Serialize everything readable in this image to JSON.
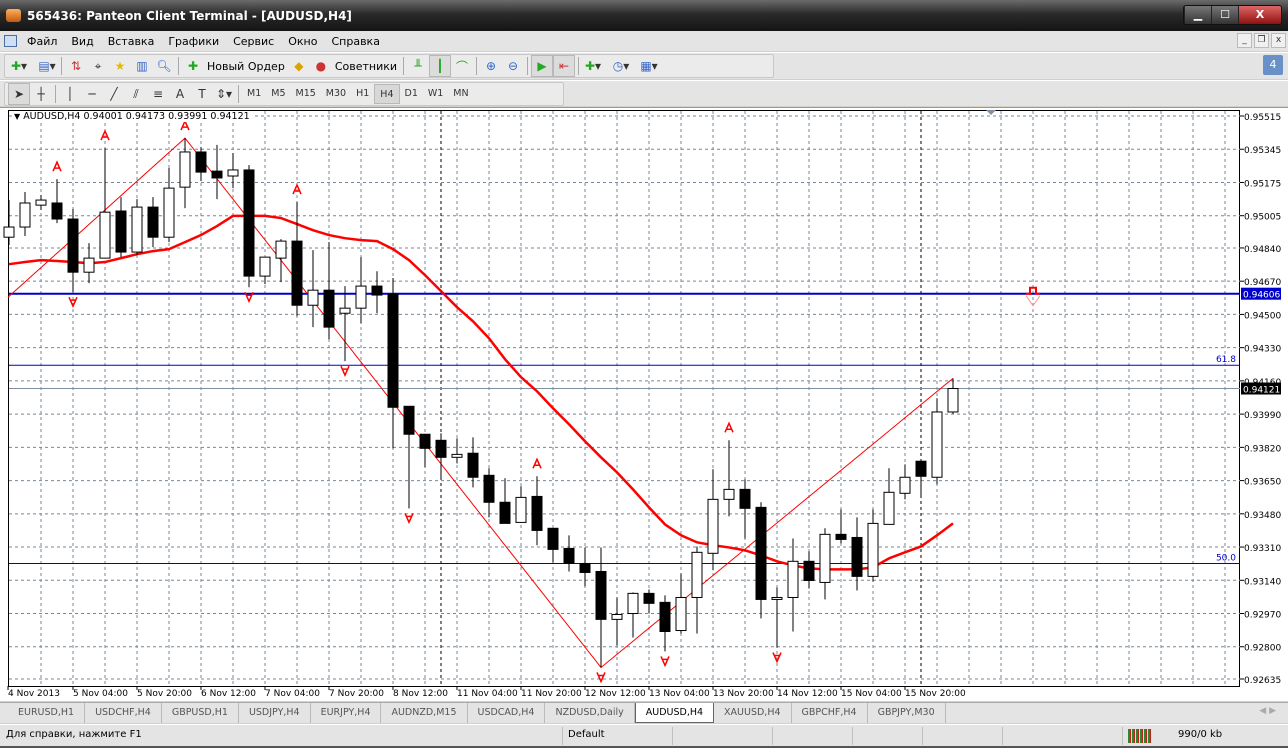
{
  "window": {
    "title": "565436: Panteon Client Terminal - [AUDUSD,H4]",
    "min": "▁",
    "max": "☐",
    "close": "X"
  },
  "menu": {
    "items": [
      "Файл",
      "Вид",
      "Вставка",
      "Графики",
      "Сервис",
      "Окно",
      "Справка"
    ],
    "mdi": [
      "_",
      "❐",
      "x"
    ]
  },
  "toolbar": {
    "new_order": "Новый Ордер",
    "experts": "Советники",
    "notifications": "4"
  },
  "timeframes": {
    "items": [
      "M1",
      "M5",
      "M15",
      "M30",
      "H1",
      "H4",
      "D1",
      "W1",
      "MN"
    ],
    "active": "H4"
  },
  "chart_header": "AUDUSD,H4  0.94001 0.94173 0.93991 0.94121",
  "colors": {
    "bull_body": "#ffffff",
    "bear_body": "#000000",
    "ma": "#ff0000",
    "zigzag": "#ff0000",
    "hline": "#0000cc",
    "fibo": "#0000cc",
    "grid": "#778899"
  },
  "chart_data": {
    "type": "candlestick",
    "symbol": "AUDUSD",
    "timeframe": "H4",
    "ylim": [
      0.92635,
      0.95515
    ],
    "grid": true,
    "price_ticks": [
      "0.95515",
      "0.95345",
      "0.95175",
      "0.95005",
      "0.94840",
      "0.94670",
      "0.94500",
      "0.94330",
      "0.94160",
      "0.93990",
      "0.93820",
      "0.93650",
      "0.93480",
      "0.93310",
      "0.93140",
      "0.92970",
      "0.92800",
      "0.92635"
    ],
    "time_labels": [
      {
        "i": 0,
        "t": "4 Nov 2013"
      },
      {
        "i": 4,
        "t": "5 Nov 04:00"
      },
      {
        "i": 8,
        "t": "5 Nov 20:00"
      },
      {
        "i": 12,
        "t": "6 Nov 12:00"
      },
      {
        "i": 16,
        "t": "7 Nov 04:00"
      },
      {
        "i": 20,
        "t": "7 Nov 20:00"
      },
      {
        "i": 24,
        "t": "8 Nov 12:00"
      },
      {
        "i": 28,
        "t": "11 Nov 04:00"
      },
      {
        "i": 32,
        "t": "11 Nov 20:00"
      },
      {
        "i": 36,
        "t": "12 Nov 12:00"
      },
      {
        "i": 40,
        "t": "13 Nov 04:00"
      },
      {
        "i": 44,
        "t": "13 Nov 20:00"
      },
      {
        "i": 48,
        "t": "14 Nov 12:00"
      },
      {
        "i": 52,
        "t": "15 Nov 04:00"
      },
      {
        "i": 56,
        "t": "15 Nov 20:00"
      }
    ],
    "open": [
      0.94895,
      0.94947,
      0.95059,
      0.9507,
      0.94988,
      0.94716,
      0.94788,
      0.95029,
      0.94819,
      0.95049,
      0.94895,
      0.95151,
      0.95331,
      0.95233,
      0.95208,
      0.95239,
      0.94696,
      0.94788,
      0.94875,
      0.94547,
      0.94624,
      0.94506,
      0.94532,
      0.94645,
      0.94604,
      0.9403,
      0.93887,
      0.93856,
      0.93769,
      0.9379,
      0.93677,
      0.93539,
      0.93436,
      0.93569,
      0.93406,
      0.93303,
      0.93226,
      0.93185,
      0.9294,
      0.9297,
      0.93073,
      0.93027,
      0.92883,
      0.93052,
      0.93278,
      0.93554,
      0.93605,
      0.93513,
      0.93042,
      0.93052,
      0.93237,
      0.93129,
      0.93375,
      0.93359,
      0.9316,
      0.93426,
      0.93585,
      0.93749,
      0.93667,
      0.94001
    ],
    "high": [
      0.95085,
      0.95126,
      0.95111,
      0.95192,
      0.95039,
      0.94865,
      0.95351,
      0.951,
      0.9509,
      0.951,
      0.95249,
      0.95402,
      0.95356,
      0.95367,
      0.95326,
      0.95264,
      0.94793,
      0.94885,
      0.95075,
      0.94829,
      0.9487,
      0.94645,
      0.94793,
      0.94721,
      0.94686,
      0.9403,
      0.93887,
      0.93892,
      0.93866,
      0.93871,
      0.93713,
      0.93662,
      0.93621,
      0.93672,
      0.93406,
      0.9337,
      0.93308,
      0.93308,
      0.93052,
      0.93078,
      0.93093,
      0.93063,
      0.93175,
      0.93313,
      0.93708,
      0.93856,
      0.93656,
      0.93539,
      0.93103,
      0.93354,
      0.93288,
      0.93406,
      0.93503,
      0.93462,
      0.93503,
      0.93713,
      0.93733,
      0.93749,
      0.94071,
      0.94173
    ],
    "low": [
      0.94855,
      0.94901,
      0.95034,
      0.94967,
      0.94614,
      0.9466,
      0.94788,
      0.94793,
      0.94803,
      0.94844,
      0.9487,
      0.95044,
      0.95182,
      0.9509,
      0.95146,
      0.94639,
      0.94655,
      0.94665,
      0.94491,
      0.94435,
      0.94373,
      0.94261,
      0.94455,
      0.94506,
      0.93815,
      0.93508,
      0.93718,
      0.93662,
      0.93738,
      0.93615,
      0.93462,
      0.93431,
      0.93436,
      0.93319,
      0.93231,
      0.93185,
      0.93109,
      0.92694,
      0.92807,
      0.92847,
      0.9297,
      0.92776,
      0.92868,
      0.92868,
      0.93191,
      0.93467,
      0.93354,
      0.92945,
      0.92796,
      0.92878,
      0.93098,
      0.93042,
      0.93329,
      0.93088,
      0.93134,
      0.93426,
      0.93554,
      0.93569,
      0.93631,
      0.93991
    ],
    "close": [
      0.94947,
      0.9507,
      0.95085,
      0.94988,
      0.94716,
      0.94788,
      0.95023,
      0.94819,
      0.95049,
      0.94895,
      0.95146,
      0.95331,
      0.95228,
      0.95198,
      0.95239,
      0.94696,
      0.94793,
      0.94875,
      0.94547,
      0.94624,
      0.94435,
      0.94532,
      0.94645,
      0.94599,
      0.94025,
      0.93887,
      0.93815,
      0.93769,
      0.93784,
      0.93667,
      0.93539,
      0.93431,
      0.93564,
      0.93395,
      0.93298,
      0.93226,
      0.9318,
      0.9294,
      0.92965,
      0.93073,
      0.93022,
      0.92878,
      0.93052,
      0.93283,
      0.93554,
      0.93605,
      0.93508,
      0.93042,
      0.93052,
      0.93237,
      0.93139,
      0.93375,
      0.93349,
      0.9316,
      0.93431,
      0.9359,
      0.93667,
      0.93672,
      0.94001,
      0.94121
    ],
    "ma": [
      0.94757,
      0.94768,
      0.94778,
      0.94773,
      0.94768,
      0.94762,
      0.94768,
      0.94788,
      0.94808,
      0.94824,
      0.94834,
      0.9487,
      0.94906,
      0.94952,
      0.95004,
      0.95004,
      0.95004,
      0.94993,
      0.94962,
      0.94931,
      0.94906,
      0.9489,
      0.9488,
      0.94875,
      0.94834,
      0.94778,
      0.94701,
      0.94619,
      0.94537,
      0.94465,
      0.94378,
      0.94271,
      0.94179,
      0.94107,
      0.9402,
      0.93938,
      0.93851,
      0.93769,
      0.93692,
      0.93605,
      0.93513,
      0.93426,
      0.9337,
      0.93334,
      0.93319,
      0.93308,
      0.93293,
      0.93267,
      0.93237,
      0.93216,
      0.93201,
      0.93196,
      0.93196,
      0.93196,
      0.93206,
      0.93252,
      0.93283,
      0.93313,
      0.9337,
      0.93431
    ],
    "zigzag": [
      {
        "i": 0,
        "p": 0.94588
      },
      {
        "i": 11,
        "p": 0.95402
      },
      {
        "i": 37,
        "p": 0.92694
      },
      {
        "i": 59,
        "p": 0.94173
      }
    ],
    "fractals_up": [
      3,
      6,
      11,
      18,
      33,
      45
    ],
    "fractals_down": [
      4,
      15,
      21,
      25,
      37,
      41,
      48
    ],
    "period_separators": [
      27,
      57
    ],
    "hline": {
      "price": 0.94606,
      "label": "0.94606"
    },
    "fibo": [
      {
        "price": 0.9424,
        "label": "61.8"
      },
      {
        "price": 0.93226,
        "label": "50.0"
      }
    ],
    "bid": {
      "price": 0.94121,
      "label": "0.94121"
    },
    "alert_price": 0.94606
  },
  "tabs": {
    "items": [
      "EURUSD,H1",
      "USDCHF,H4",
      "GBPUSD,H1",
      "USDJPY,H4",
      "EURJPY,H4",
      "AUDNZD,M15",
      "USDCAD,H4",
      "NZDUSD,Daily",
      "AUDUSD,H4",
      "XAUUSD,H4",
      "GBPCHF,H4",
      "GBPJPY,M30"
    ],
    "active": "AUDUSD,H4",
    "arrows": "◀ ▶"
  },
  "status": {
    "help": "Для справки, нажмите F1",
    "profile": "Default",
    "traffic": "990/0 kb"
  }
}
